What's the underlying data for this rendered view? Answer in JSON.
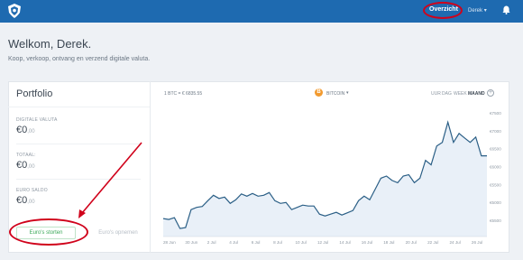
{
  "topbar": {
    "nav_active": "Overzicht",
    "user": "Derek",
    "user_caret": "▾"
  },
  "welcome": {
    "title": "Welkom, Derek.",
    "subtitle": "Koop, verkoop, ontvang en verzend digitale valuta."
  },
  "portfolio": {
    "title": "Portfolio",
    "stats": [
      {
        "label": "DIGITALE VALUTA",
        "whole": "€0",
        "dec": ",00"
      },
      {
        "label": "TOTAAL:",
        "whole": "€0",
        "dec": ",00"
      },
      {
        "label": "EURO SALDO",
        "whole": "€0",
        "dec": ",00"
      }
    ],
    "deposit_button": "Euro's storten",
    "withdraw_button": "Euro's opnemen"
  },
  "chart_header": {
    "rate": "1 BTC = € 6835.55",
    "currency": "BITCOIN",
    "currency_caret": "▾",
    "coin_symbol": "B",
    "ranges": [
      "UUR",
      "DAG",
      "WEEK",
      "MAAND"
    ],
    "active_range": "MAAND",
    "add_label": "+"
  },
  "chart_data": {
    "type": "area",
    "x_ticks": [
      "28 Jun",
      "30 Jun",
      "2 Jul",
      "4 Jul",
      "6 Jul",
      "8 Jul",
      "10 Jul",
      "12 Jul",
      "14 Jul",
      "16 Jul",
      "18 Jul",
      "20 Jul",
      "22 Jul",
      "24 Jul",
      "26 Jul"
    ],
    "y_ticks": [
      "€5500",
      "€5000",
      "€5500",
      "€6000",
      "€6500",
      "€7000",
      "€7500"
    ],
    "ylim": [
      4800,
      7700
    ],
    "x": [
      0,
      0.5,
      1,
      1.5,
      2,
      2.5,
      3,
      3.5,
      4,
      4.5,
      5,
      5.5,
      6,
      6.5,
      7,
      7.5,
      8,
      8.5,
      9,
      9.5,
      10,
      10.5,
      11,
      11.5,
      12,
      12.5,
      13,
      13.5,
      14,
      14.5,
      15,
      15.5,
      16,
      16.5,
      17,
      17.5,
      18,
      18.5,
      19,
      19.5,
      20,
      20.5,
      21,
      21.5,
      22,
      22.5,
      23,
      23.5,
      24,
      24.5,
      25,
      25.5,
      26,
      26.5,
      27,
      27.5,
      28,
      28.5,
      29
    ],
    "values": [
      5200,
      5180,
      5220,
      4980,
      5000,
      5400,
      5450,
      5470,
      5600,
      5720,
      5650,
      5680,
      5540,
      5620,
      5750,
      5700,
      5760,
      5700,
      5720,
      5780,
      5600,
      5540,
      5560,
      5400,
      5450,
      5500,
      5480,
      5480,
      5300,
      5260,
      5300,
      5340,
      5280,
      5330,
      5380,
      5600,
      5700,
      5620,
      5860,
      6100,
      6150,
      6050,
      6000,
      6150,
      6180,
      6000,
      6100,
      6500,
      6400,
      6820,
      6900,
      7350,
      6900,
      7100,
      7000,
      6900,
      7020,
      6600,
      6600
    ],
    "line_color": "#2b5f86",
    "fill_color": "#e9f0f8",
    "grid": false
  },
  "colors": {
    "topbar": "#1e6ab0",
    "annotation": "#d0021b",
    "deposit": "#3aa858"
  },
  "icons": {
    "logo": "shield-logo-icon",
    "bell": "bell-icon",
    "plus": "plus-circle-icon",
    "coin": "bitcoin-coin-icon"
  }
}
